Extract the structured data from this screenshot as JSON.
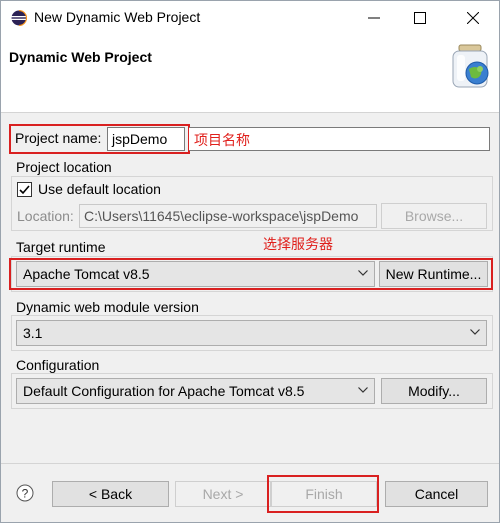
{
  "window": {
    "title": "New Dynamic Web Project"
  },
  "header": {
    "title": "Dynamic Web Project"
  },
  "project": {
    "name_label": "Project name:",
    "name_value": "jspDemo",
    "annotation": "项目名称"
  },
  "location": {
    "group_label": "Project location",
    "use_default_label": "Use default location",
    "use_default_checked": true,
    "location_label": "Location:",
    "location_value": "C:\\Users\\11645\\eclipse-workspace\\jspDemo",
    "browse_label": "Browse..."
  },
  "runtime": {
    "group_label": "Target runtime",
    "annotation": "选择服务器",
    "selected": "Apache Tomcat v8.5",
    "new_runtime_label": "New Runtime..."
  },
  "module": {
    "group_label": "Dynamic web module version",
    "selected": "3.1"
  },
  "configuration": {
    "group_label": "Configuration",
    "selected": "Default Configuration for Apache Tomcat v8.5",
    "modify_label": "Modify..."
  },
  "footer": {
    "back_label": "< Back",
    "next_label": "Next >",
    "finish_label": "Finish",
    "cancel_label": "Cancel"
  },
  "colors": {
    "annotation_red": "#d92020",
    "header_bg": "#ffffff",
    "dialog_bg": "#f0f0f0"
  }
}
